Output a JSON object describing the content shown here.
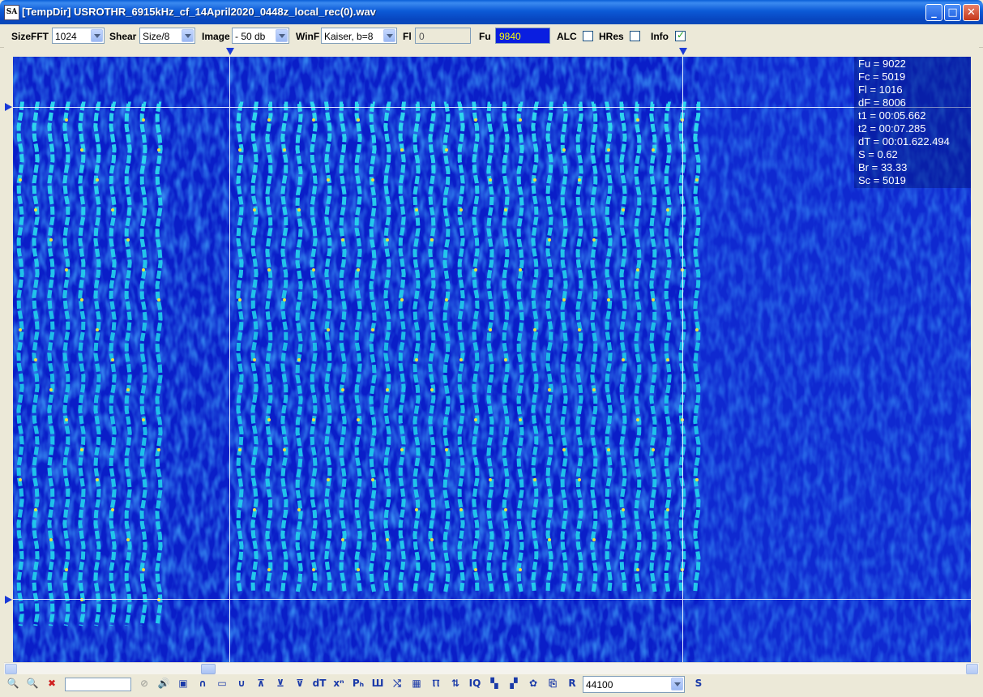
{
  "window": {
    "title": "[TempDir] USROTHR_6915kHz_cf_14April2020_0448z_local_rec(0).wav",
    "app_icon_text": "SA"
  },
  "toolbar": {
    "sizefft_label": "SizeFFT",
    "sizefft_value": "1024",
    "shear_label": "Shear",
    "shear_value": "Size/8",
    "image_label": "Image",
    "image_value": "- 50 db",
    "winf_label": "WinF",
    "winf_value": "Kaiser, b=8",
    "fl_label": "Fl",
    "fl_value": "0",
    "fu_label": "Fu",
    "fu_value": "9840",
    "alc_label": "ALC",
    "alc_checked": false,
    "hres_label": "HRes",
    "hres_checked": false,
    "info_label": "Info",
    "info_checked": true
  },
  "info_panel": [
    "Fu = 9022",
    "Fc = 5019",
    "Fl = 1016",
    "dF = 8006",
    "t1 = 00:05.662",
    "t2 = 00:07.285",
    "dT = 00:01.622.494",
    "S = 0.62",
    "Br = 33.33",
    "Sc = 5019"
  ],
  "bottom_toolbar": {
    "sample_rate": "44100",
    "icons": [
      "zoom-in-icon",
      "zoom-out-icon",
      "clear-icon",
      "disabled-icon",
      "speaker-icon",
      "stop-icon",
      "lowpass-icon",
      "rect-window-icon",
      "highpass-icon",
      "marker-up-icon",
      "marker-down-icon",
      "marker-both-icon",
      "dt-icon",
      "x-power-icon",
      "ph-icon",
      "comb-icon",
      "cross-icon",
      "grid-icon",
      "pulse-icon",
      "bars-icon",
      "iq-icon",
      "pattern1-icon",
      "pattern2-icon",
      "gear-icon",
      "copy-icon",
      "r-icon",
      "s-icon"
    ],
    "icon_glyphs": [
      "🔍",
      "🔍",
      "✖",
      "⊘",
      "🔊",
      "▣",
      "∩",
      "▭",
      "∪",
      "⊼",
      "⊻",
      "⊽",
      "dT",
      "xⁿ",
      "Pₕ",
      "Ш",
      "⤭",
      "▦",
      "Ⲡ",
      "⇅",
      "IQ",
      "▚",
      "▞",
      "✿",
      "⎘",
      "R",
      "S"
    ]
  },
  "colors": {
    "titlebar": "#0a5fd8",
    "fu_field_bg": "#0a1ee0",
    "fu_field_text": "#ffff00",
    "spectrogram_bg": "#0a1ec8",
    "signal": "#22d8ee"
  }
}
